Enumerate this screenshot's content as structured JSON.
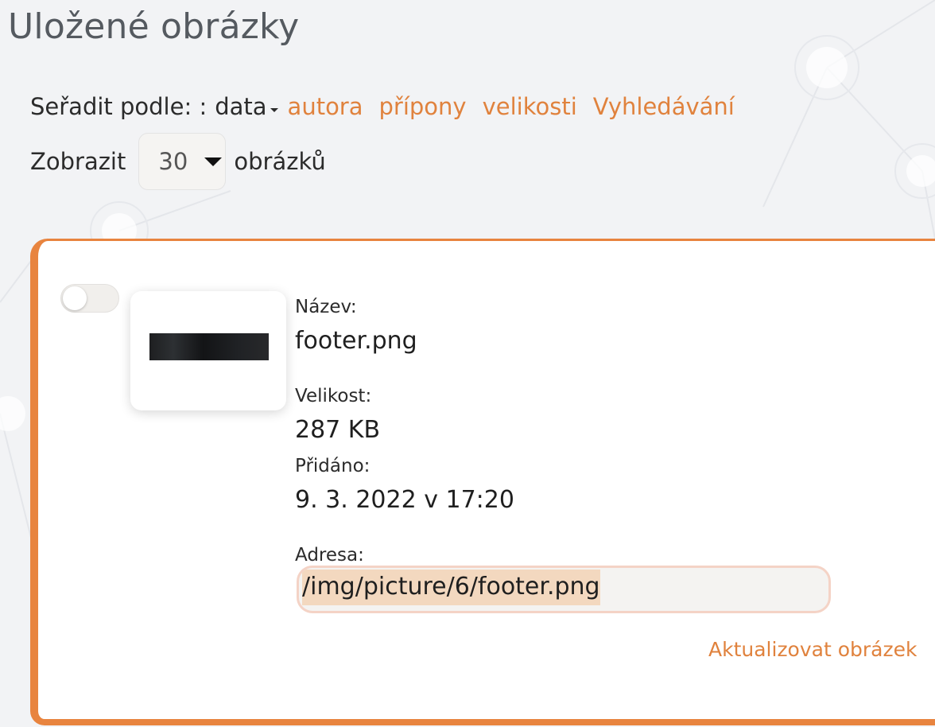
{
  "page": {
    "title": "Uložené obrázky"
  },
  "sort": {
    "label": "Seřadit podle: :",
    "active": "data",
    "links": [
      "autora",
      "přípony",
      "velikosti",
      "Vyhledávání"
    ]
  },
  "show": {
    "label_before": "Zobrazit",
    "per_page": "30",
    "label_after": "obrázků"
  },
  "image": {
    "name_label": "Název:",
    "name": "footer.png",
    "size_label": "Velikost:",
    "size": "287 KB",
    "added_label": "Přidáno:",
    "added": "9. 3. 2022 v 17:20",
    "address_label": "Adresa:",
    "address": "/img/picture/6/footer.png",
    "update_label": "Aktualizovat obrázek",
    "selected": false
  },
  "colors": {
    "accent": "#e0823d",
    "card_border": "#e8843f",
    "background": "#f2f3f5"
  }
}
